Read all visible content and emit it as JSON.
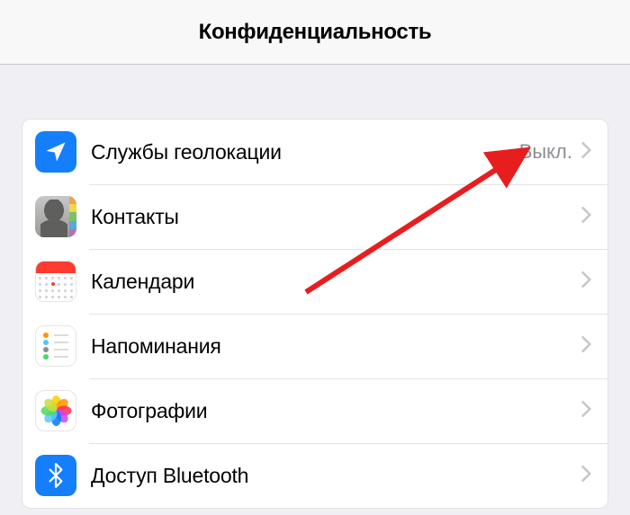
{
  "header": {
    "title": "Конфиденциальность"
  },
  "settings": {
    "location": {
      "label": "Службы геолокации",
      "value": "Выкл."
    },
    "contacts": {
      "label": "Контакты"
    },
    "calendars": {
      "label": "Календари"
    },
    "reminders": {
      "label": "Напоминания"
    },
    "photos": {
      "label": "Фотографии"
    },
    "bluetooth": {
      "label": "Доступ Bluetooth"
    }
  }
}
